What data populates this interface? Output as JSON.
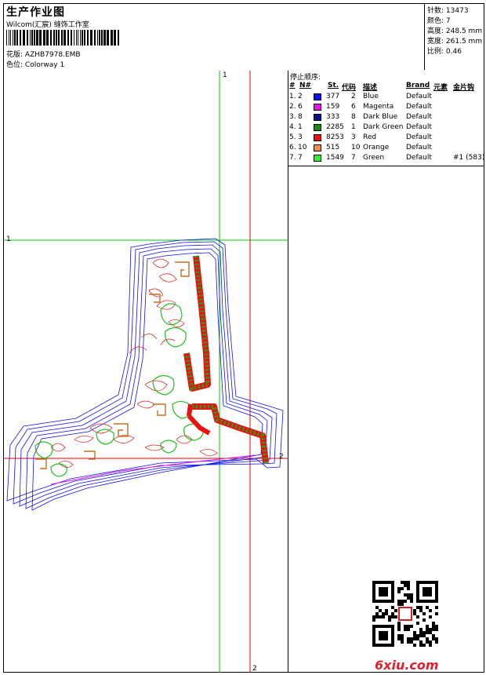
{
  "header": {
    "title": "生产作业图",
    "company": "Wilcom(汇宸) 缝饰工作室",
    "design_label": "花版:",
    "design_value": "AZHB7978.EMB",
    "colorway_label": "色位:",
    "colorway_value": "Colorway 1",
    "stats": [
      {
        "label": "针数:",
        "value": "13473"
      },
      {
        "label": "颜色:",
        "value": "7"
      },
      {
        "label": "高度:",
        "value": "248.5 mm"
      },
      {
        "label": "宽度:",
        "value": "261.5 mm"
      },
      {
        "label": "比例:",
        "value": "0.46"
      }
    ]
  },
  "stop_sequence": {
    "title": "停止顺序:",
    "columns": [
      "#",
      "N#",
      "St.",
      "代码",
      "描述",
      "Brand",
      "元素",
      "金片钩"
    ],
    "rows": [
      {
        "num": "1.",
        "n": "2",
        "color": "#1010ee",
        "st": "377",
        "code": "2",
        "desc": "Blue",
        "brand": "Default",
        "extra": ""
      },
      {
        "num": "2.",
        "n": "6",
        "color": "#ee10ee",
        "st": "159",
        "code": "6",
        "desc": "Magenta",
        "brand": "Default",
        "extra": ""
      },
      {
        "num": "3.",
        "n": "8",
        "color": "#10108a",
        "st": "333",
        "code": "8",
        "desc": "Dark Blue",
        "brand": "Default",
        "extra": ""
      },
      {
        "num": "4.",
        "n": "1",
        "color": "#158a15",
        "st": "2285",
        "code": "1",
        "desc": "Dark Green",
        "brand": "Default",
        "extra": ""
      },
      {
        "num": "5.",
        "n": "3",
        "color": "#ee1010",
        "st": "8253",
        "code": "3",
        "desc": "Red",
        "brand": "Default",
        "extra": ""
      },
      {
        "num": "6.",
        "n": "10",
        "color": "#ee9040",
        "st": "515",
        "code": "10",
        "desc": "Orange",
        "brand": "Default",
        "extra": ""
      },
      {
        "num": "7.",
        "n": "7",
        "color": "#30ee30",
        "st": "1549",
        "code": "7",
        "desc": "Green",
        "brand": "Default",
        "extra": "#1 (583)"
      }
    ]
  },
  "guides": {
    "top_v": "1",
    "left_h": "1",
    "bottom_v": "2",
    "right_h": "2"
  },
  "watermark": "6xiu.com"
}
